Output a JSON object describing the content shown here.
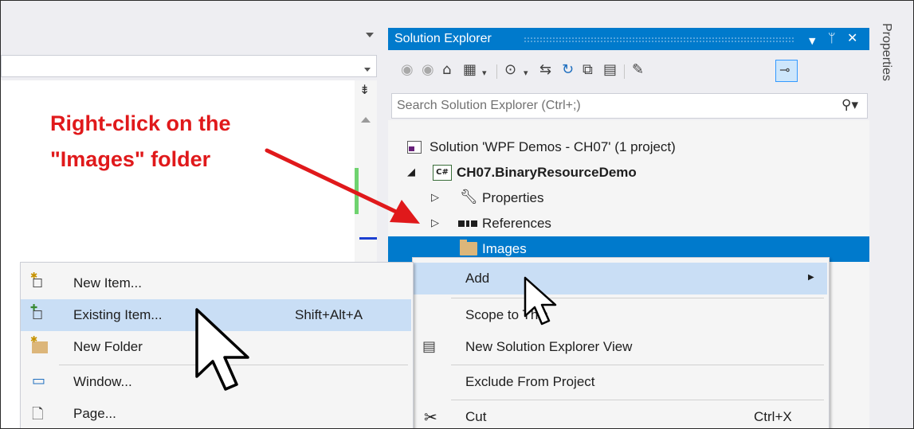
{
  "annotation": {
    "line1": "Right-click on the",
    "line2": "\"Images\" folder"
  },
  "solution_explorer": {
    "title": "Solution Explorer",
    "search_placeholder": "Search Solution Explorer (Ctrl+;)",
    "tree": {
      "solution": "Solution 'WPF Demos - CH07' (1 project)",
      "project": "CH07.BinaryResourceDemo",
      "project_badge": "C#",
      "properties": "Properties",
      "references": "References",
      "images": "Images"
    }
  },
  "properties_tab": "Properties",
  "context_menu": {
    "items": [
      {
        "label": "Add",
        "icon": "none",
        "shortcut": ""
      },
      {
        "label": "Scope to This",
        "icon": "none",
        "shortcut": ""
      },
      {
        "label": "New Solution Explorer View",
        "icon": "new-view-icon",
        "shortcut": ""
      },
      {
        "label": "Exclude From Project",
        "icon": "none",
        "shortcut": ""
      },
      {
        "label": "Cut",
        "icon": "scissors-icon",
        "shortcut": "Ctrl+X"
      }
    ]
  },
  "add_submenu": {
    "items": [
      {
        "label": "New Item...",
        "icon": "new-item-icon",
        "shortcut": ""
      },
      {
        "label": "Existing Item...",
        "icon": "existing-item-icon",
        "shortcut": "Shift+Alt+A"
      },
      {
        "label": "New Folder",
        "icon": "new-folder-icon",
        "shortcut": ""
      },
      {
        "label": "Window...",
        "icon": "window-icon",
        "shortcut": ""
      },
      {
        "label": "Page...",
        "icon": "page-icon",
        "shortcut": ""
      }
    ]
  },
  "colors": {
    "accent": "#007acc",
    "annotation": "#e0191b",
    "menu_highlight": "#c9def5"
  }
}
